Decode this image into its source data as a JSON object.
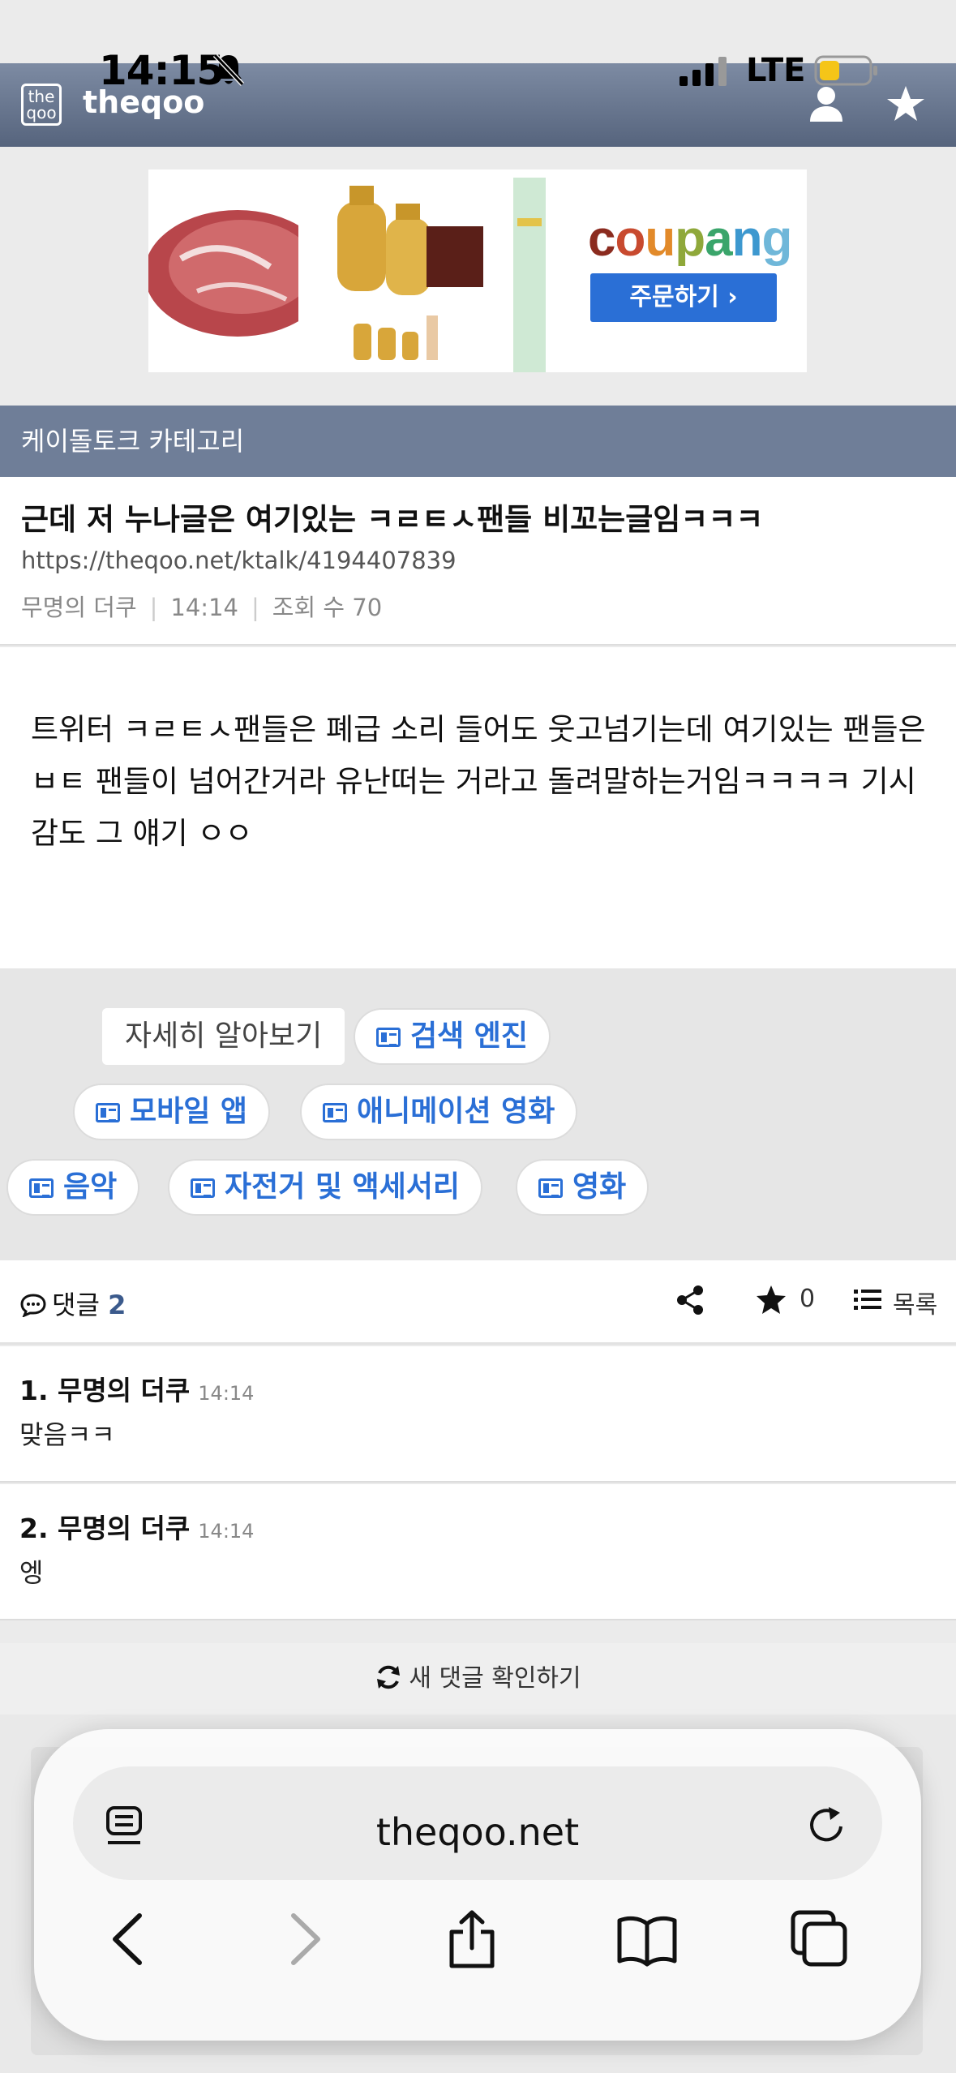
{
  "status_bar": {
    "time": "14:15",
    "network": "LTE"
  },
  "header": {
    "logo_text_top": "the",
    "logo_text_bottom": "qoo",
    "site_name": "theqoo"
  },
  "ad": {
    "brand": [
      "c",
      "o",
      "u",
      "p",
      "a",
      "n",
      "g"
    ],
    "button_label": "주문하기 ›"
  },
  "category_bar": {
    "label": "케이돌토크 카테고리"
  },
  "article": {
    "title": "근데 저 누나글은 여기있는 ㅋㄹㅌㅅ팬들 비꼬는글임ㅋㅋㅋ",
    "url": "https://theqoo.net/ktalk/4194407839",
    "author": "무명의 더쿠",
    "time": "14:14",
    "views": "조회 수 70",
    "body": "트위터 ㅋㄹㅌㅅ팬들은 폐급 소리 들어도 웃고넘기는데 여기있는 팬들은 ㅂㅌ 팬들이 넘어간거라 유난떠는 거라고 돌려말하는거임ㅋㅋㅋㅋ 기시감도 그 얘기 ㅇㅇ"
  },
  "tags": {
    "learn_more": "자세히 알아보기",
    "items": [
      "검색 엔진",
      "모바일 앱",
      "애니메이션 영화",
      "음악",
      "자전거 및 액세서리",
      "영화"
    ]
  },
  "comment_bar": {
    "label": "댓글",
    "count": "2",
    "star_count": "0",
    "list_label": "목록"
  },
  "comments": [
    {
      "author": "1. 무명의 더쿠",
      "time": "14:14",
      "text": "맞음ㅋㅋ"
    },
    {
      "author": "2. 무명의 더쿠",
      "time": "14:14",
      "text": "엥"
    }
  ],
  "new_comments": {
    "label": "새 댓글 확인하기"
  },
  "browser": {
    "url": "theqoo.net"
  },
  "colors": {
    "header": "#56647d",
    "category": "#6f7e98",
    "link_blue": "#2a6fd6",
    "comment_count": "#3b5a8c"
  }
}
